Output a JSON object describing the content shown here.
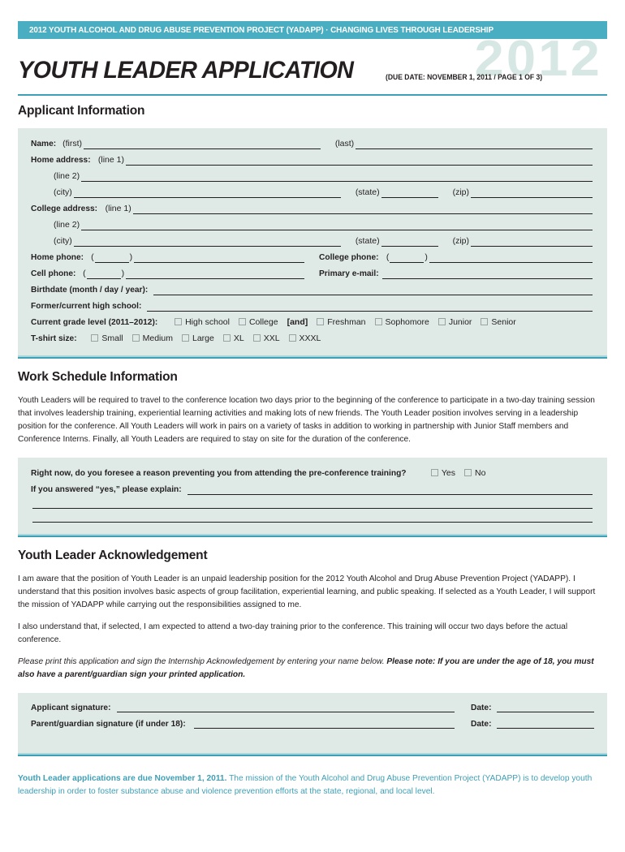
{
  "header": {
    "banner": "2012 YOUTH ALCOHOL AND DRUG ABUSE PREVENTION PROJECT (YADAPP) · CHANGING LIVES THROUGH LEADERSHIP",
    "title": "YOUTH LEADER APPLICATION",
    "due_date": "(DUE DATE: NOVEMBER 1, 2011 / PAGE 1 OF 3)",
    "watermark_year": "2012",
    "colors": {
      "banner_bg": "#4aaec2",
      "rule_dark": "#3f9fb5",
      "rule_light": "#a8d7dd",
      "panel_bg": "#dfeae6",
      "watermark": "#d7e7e4",
      "footer_text": "#3f9fb5",
      "ink": "#231f20"
    }
  },
  "applicant": {
    "heading": "Applicant Information",
    "name_label": "Name:",
    "name_first": "(first)",
    "name_last": "(last)",
    "home_address_label": "Home address:",
    "college_address_label": "College address:",
    "line1": "(line 1)",
    "line2": "(line 2)",
    "city": "(city)",
    "state": "(state)",
    "zip": "(zip)",
    "home_phone_label": "Home phone:",
    "college_phone_label": "College phone:",
    "cell_phone_label": "Cell phone:",
    "primary_email_label": "Primary e-mail:",
    "birthdate_label": "Birthdate (month / day / year):",
    "high_school_label": "Former/current high school:",
    "grade_level_label": "Current grade level (2011–2012):",
    "and_label": "[and]",
    "grade_options_a": [
      "High school",
      "College"
    ],
    "grade_options_b": [
      "Freshman",
      "Sophomore",
      "Junior",
      "Senior"
    ],
    "tshirt_label": "T-shirt size:",
    "tshirt_options": [
      "Small",
      "Medium",
      "Large",
      "XL",
      "XXL",
      "XXXL"
    ]
  },
  "work_schedule": {
    "heading": "Work Schedule Information",
    "paragraph": "Youth Leaders will be required to travel to the conference location two days prior to the beginning of the conference to participate in a two-day training session that involves leadership training, experiential learning activities and making lots of new friends. The Youth Leader position involves serving in a leadership position for the conference. All Youth Leaders will work in pairs on a variety of tasks in addition to working in partnership with Junior Staff members and Conference Interns. Finally, all Youth Leaders are required to stay on site for the duration of the conference.",
    "question": "Right now, do you foresee a reason preventing you from attending the pre-conference training?",
    "yes_label": "Yes",
    "no_label": "No",
    "explain_label": "If you answered “yes,” please explain:"
  },
  "acknowledgement": {
    "heading": "Youth Leader Acknowledgement",
    "paragraph1": "I am aware that the position of Youth Leader is an unpaid leadership position for the 2012 Youth Alcohol and Drug Abuse Prevention Project (YADAPP). I understand that this position involves basic aspects of group facilitation, experiential learning, and public speaking. If selected as a Youth Leader, I will support the mission of YADAPP while carrying out the responsibilities assigned to me.",
    "paragraph2": "I also understand that, if selected, I am expected to attend a two-day training prior to the conference. This training will occur two days before the actual conference.",
    "note_plain": "Please print this application and sign the Internship Acknowledgement by entering your name below. ",
    "note_bold": "Please note: If you are under the age of 18, you must also have a parent/guardian sign your printed application.",
    "applicant_signature_label": "Applicant signature:",
    "parent_signature_label": "Parent/guardian signature (if under 18):",
    "date_label": "Date:"
  },
  "footer": {
    "bold_lead": "Youth Leader applications are due November 1, 2011.",
    "rest": " The mission of the Youth Alcohol and Drug Abuse Prevention Project (YADAPP) is to develop youth leadership in order to foster substance abuse and violence prevention efforts at the state, regional, and local level."
  }
}
